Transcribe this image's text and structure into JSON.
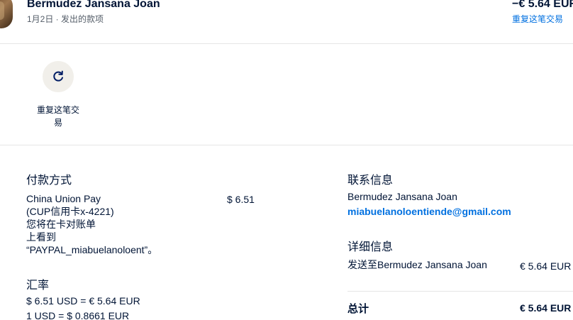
{
  "header": {
    "name": "Bermudez Jansana Joan",
    "subtitle": "1月2日 · 发出的款项",
    "amount": "−€ 5.64 EUR",
    "repeat_link": "重复这笔交易"
  },
  "action": {
    "icon": "refresh-icon",
    "label": "重复这笔交易"
  },
  "payment": {
    "title": "付款方式",
    "method_lines": [
      "China Union Pay",
      "(CUP信用卡x-4221)",
      "您将在卡对账单",
      "上看到",
      "“PAYPAL_miabuelanoloent”。"
    ],
    "amount": "$ 6.51"
  },
  "exchange": {
    "title": "汇率",
    "line1": "$ 6.51 USD = € 5.64 EUR",
    "line2": "1 USD = $ 0.8661 EUR"
  },
  "contact": {
    "title": "联系信息",
    "name": "Bermudez Jansana Joan",
    "email": "miabuelanoloentiende@gmail.com"
  },
  "details": {
    "title": "详细信息",
    "sent_to_label": "发送至Bermudez Jansana Joan",
    "sent_to_amount": "€ 5.64 EUR",
    "total_label": "总计",
    "total_amount": "€ 5.64 EUR"
  },
  "colors": {
    "text": "#001435",
    "link": "#0070e0",
    "muted": "#545d68",
    "divider": "#e6e6e6",
    "action_bg": "#f1efea"
  }
}
